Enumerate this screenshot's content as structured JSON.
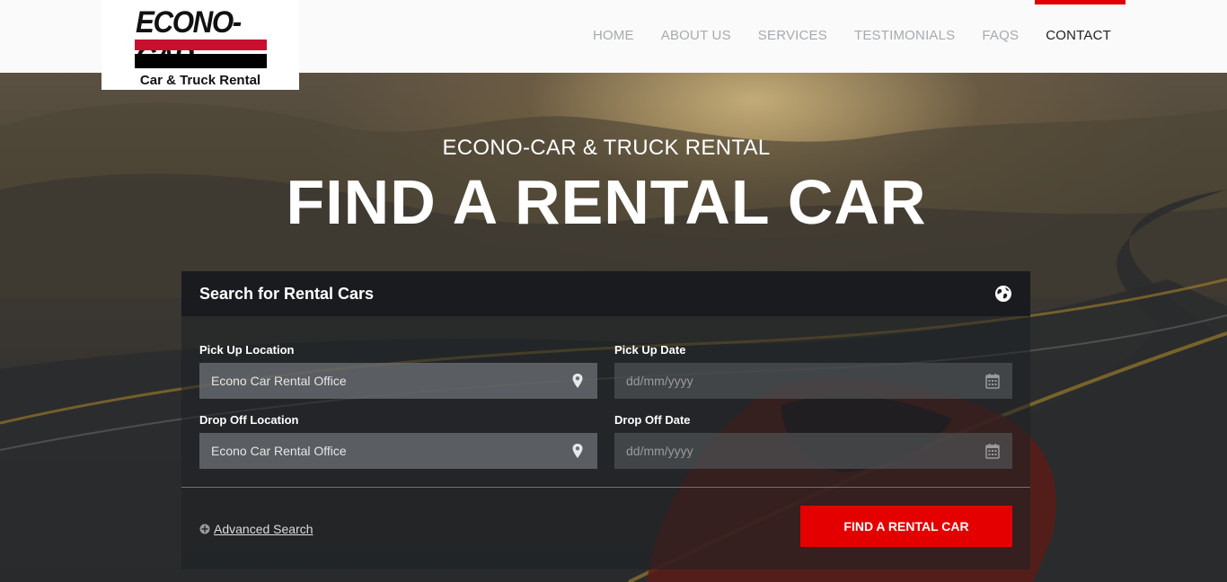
{
  "logo": {
    "brand": "ECONO-CAR",
    "tagline": "Car & Truck Rental"
  },
  "nav": {
    "items": [
      {
        "label": "HOME",
        "active": false
      },
      {
        "label": "ABOUT US",
        "active": false
      },
      {
        "label": "SERVICES",
        "active": false
      },
      {
        "label": "TESTIMONIALS",
        "active": false
      },
      {
        "label": "FAQS",
        "active": false
      },
      {
        "label": "CONTACT",
        "active": true
      }
    ]
  },
  "hero": {
    "subtitle": "ECONO-CAR & TRUCK RENTAL",
    "title": "FIND A RENTAL CAR"
  },
  "search": {
    "title": "Search for Rental Cars",
    "pickup_location": {
      "label": "Pick Up Location",
      "value": "Econo Car Rental Office",
      "icon": "map-pin-icon"
    },
    "pickup_date": {
      "label": "Pick Up Date",
      "placeholder": "dd/mm/yyyy",
      "icon": "calendar-icon"
    },
    "dropoff_location": {
      "label": "Drop Off Location",
      "value": "Econo Car Rental Office",
      "icon": "map-pin-icon"
    },
    "dropoff_date": {
      "label": "Drop Off Date",
      "placeholder": "dd/mm/yyyy",
      "icon": "calendar-icon"
    },
    "advanced_label": "Advanced Search",
    "submit_label": "FIND A RENTAL CAR"
  },
  "colors": {
    "accent": "#e50000",
    "logo_red": "#c8102e",
    "nav_inactive": "#a6aab0",
    "nav_active": "#222222"
  }
}
